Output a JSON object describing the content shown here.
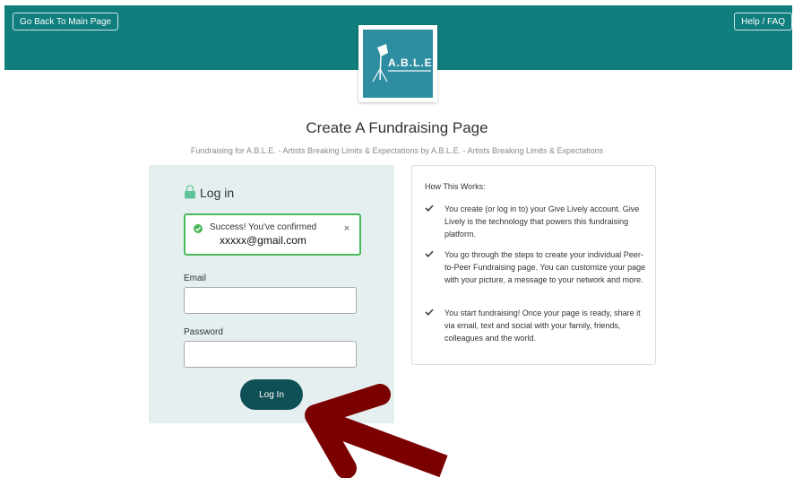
{
  "header": {
    "back_button": "Go Back To Main Page",
    "help_button": "Help / FAQ",
    "logo_text": "A.B.L.E."
  },
  "page": {
    "title": "Create A Fundraising Page",
    "subtitle": "Fundraising for A.B.L.E. - Artists Breaking Limits & Expectations by A.B.L.E. - Artists Breaking Limits & Expectations"
  },
  "login": {
    "heading": "Log in",
    "alert": {
      "message": "Success! You've confirmed",
      "email": "xxxxx@gmail.com",
      "close": "×"
    },
    "email_label": "Email",
    "email_value": "",
    "password_label": "Password",
    "password_value": "",
    "submit_label": "Log In"
  },
  "how_it_works": {
    "title": "How This Works:",
    "steps": [
      "You create (or log in to) your Give Lively account. Give Lively is the technology that powers this fundraising platform.",
      "You go through the steps to create your individual Peer-to-Peer Fundraising page. You can customize your page with your picture, a message to your network and more.",
      "You start fundraising! Once your page is ready, share it via email, text and social with your family, friends, colleagues and the world."
    ]
  },
  "colors": {
    "header": "#0f7e7c",
    "login_button": "#0f5056",
    "success_border": "#4bb85a",
    "annotation_arrow": "#7b0000"
  }
}
